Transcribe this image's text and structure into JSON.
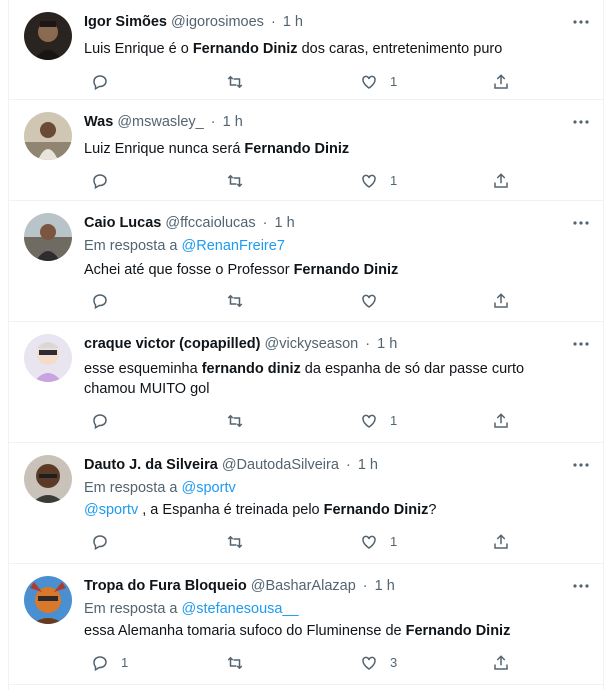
{
  "tweets": [
    {
      "name": "Igor Simões",
      "handle": "@igorosimoes",
      "time": "1 h",
      "reply_to_prefix": "",
      "reply_to": "",
      "text_parts": [
        {
          "t": "Luis Enrique é o ",
          "b": false
        },
        {
          "t": "Fernando Diniz",
          "b": true
        },
        {
          "t": " dos caras, entretenimento puro",
          "b": false
        }
      ],
      "replies": "",
      "retweets": "",
      "likes": "1"
    },
    {
      "name": "Was",
      "handle": "@mswasley_",
      "time": "1 h",
      "reply_to_prefix": "",
      "reply_to": "",
      "text_parts": [
        {
          "t": "Luiz Enrique nunca será ",
          "b": false
        },
        {
          "t": "Fernando Diniz",
          "b": true
        }
      ],
      "replies": "",
      "retweets": "",
      "likes": "1"
    },
    {
      "name": "Caio Lucas",
      "handle": "@ffccaiolucas",
      "time": "1 h",
      "reply_to_prefix": "Em resposta a ",
      "reply_to": "@RenanFreire7",
      "text_parts": [
        {
          "t": "Achei até que fosse o Professor ",
          "b": false
        },
        {
          "t": "Fernando Diniz",
          "b": true
        }
      ],
      "replies": "",
      "retweets": "",
      "likes": ""
    },
    {
      "name": "craque victor (copapilled)",
      "handle": "@vickyseason",
      "time": "1 h",
      "reply_to_prefix": "",
      "reply_to": "",
      "text_parts": [
        {
          "t": "esse esqueminha ",
          "b": false
        },
        {
          "t": "fernando diniz",
          "b": true
        },
        {
          "t": " da espanha de só dar passe curto chamou MUITO gol",
          "b": false
        }
      ],
      "replies": "",
      "retweets": "",
      "likes": "1"
    },
    {
      "name": "Dauto J. da Silveira",
      "handle": "@DautodaSilveira",
      "time": "1 h",
      "reply_to_prefix": "Em resposta a ",
      "reply_to": "@sportv",
      "text_parts": [
        {
          "t": "@sportv",
          "b": false,
          "m": true
        },
        {
          "t": " , a Espanha é treinada pelo ",
          "b": false
        },
        {
          "t": "Fernando Diniz",
          "b": true
        },
        {
          "t": "?",
          "b": false
        }
      ],
      "replies": "",
      "retweets": "",
      "likes": "1"
    },
    {
      "name": "Tropa do Fura Bloqueio",
      "handle": "@BasharAlazap",
      "time": "1 h",
      "reply_to_prefix": "Em resposta a ",
      "reply_to": "@stefanesousa__",
      "text_parts": [
        {
          "t": "essa Alemanha tomaria sufoco do Fluminense de ",
          "b": false
        },
        {
          "t": "Fernando Diniz",
          "b": true
        }
      ],
      "replies": "1",
      "retweets": "",
      "likes": "3"
    }
  ],
  "separator": "·",
  "icons": {
    "reply": "reply-icon",
    "retweet": "retweet-icon",
    "like": "heart-icon",
    "share": "share-icon",
    "more": "more-options-icon"
  },
  "colors": {
    "text": "#0f1419",
    "secondary": "#536471",
    "mention": "#1d9bf0",
    "border": "#eff3f4"
  }
}
